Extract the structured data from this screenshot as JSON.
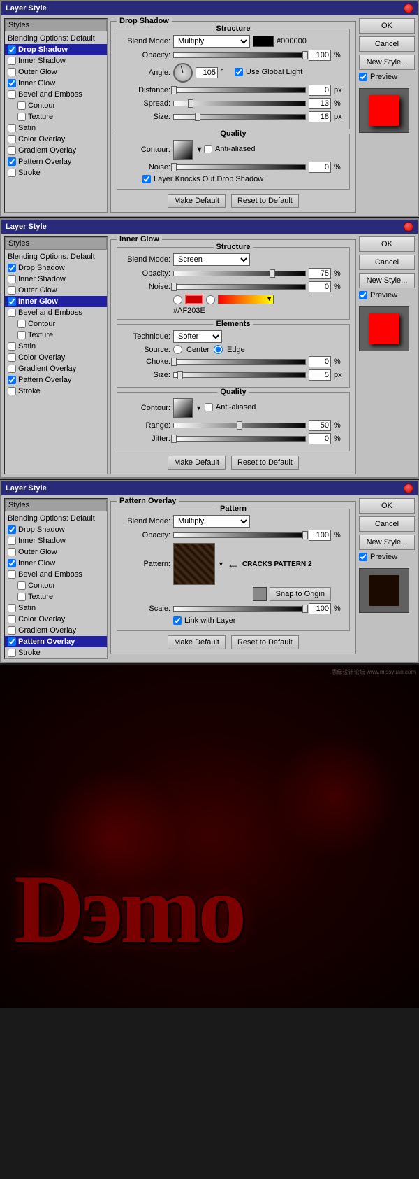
{
  "panel1": {
    "title": "Layer Style",
    "section": "Drop Shadow",
    "structure_label": "Structure",
    "blend_mode_label": "Blend Mode:",
    "blend_mode_value": "Multiply",
    "color_hex": "#000000",
    "opacity_label": "Opacity:",
    "opacity_value": "100",
    "opacity_unit": "%",
    "angle_label": "Angle:",
    "angle_value": "105",
    "angle_unit": "°",
    "use_global_light": "Use Global Light",
    "distance_label": "Distance:",
    "distance_value": "0",
    "distance_unit": "px",
    "spread_label": "Spread:",
    "spread_value": "13",
    "spread_unit": "%",
    "size_label": "Size:",
    "size_value": "18",
    "size_unit": "px",
    "quality_label": "Quality",
    "contour_label": "Contour:",
    "anti_aliased": "Anti-aliased",
    "noise_label": "Noise:",
    "noise_value": "0",
    "noise_unit": "%",
    "layer_knocks": "Layer Knocks Out Drop Shadow",
    "make_default": "Make Default",
    "reset_default": "Reset to Default",
    "ok_label": "OK",
    "cancel_label": "Cancel",
    "new_style_label": "New Style...",
    "preview_label": "Preview",
    "styles": [
      {
        "label": "Blending Options: Default",
        "checked": false,
        "active": false
      },
      {
        "label": "Drop Shadow",
        "checked": true,
        "active": true
      },
      {
        "label": "Inner Shadow",
        "checked": false,
        "active": false
      },
      {
        "label": "Outer Glow",
        "checked": false,
        "active": false
      },
      {
        "label": "Inner Glow",
        "checked": true,
        "active": false
      },
      {
        "label": "Bevel and Emboss",
        "checked": false,
        "active": false
      },
      {
        "label": "Contour",
        "checked": false,
        "sub": true
      },
      {
        "label": "Texture",
        "checked": false,
        "sub": true
      },
      {
        "label": "Satin",
        "checked": false,
        "active": false
      },
      {
        "label": "Color Overlay",
        "checked": false,
        "active": false
      },
      {
        "label": "Gradient Overlay",
        "checked": false,
        "active": false
      },
      {
        "label": "Pattern Overlay",
        "checked": true,
        "active": false
      },
      {
        "label": "Stroke",
        "checked": false,
        "active": false
      }
    ]
  },
  "panel2": {
    "title": "Layer Style",
    "section": "Inner Glow",
    "structure_label": "Structure",
    "blend_mode_label": "Blend Mode:",
    "blend_mode_value": "Screen",
    "opacity_label": "Opacity:",
    "opacity_value": "75",
    "opacity_unit": "%",
    "noise_label": "Noise:",
    "noise_value": "0",
    "noise_unit": "%",
    "color_hex": "#AF203E",
    "elements_label": "Elements",
    "technique_label": "Technique:",
    "technique_value": "Softer",
    "source_label": "Source:",
    "center_label": "Center",
    "edge_label": "Edge",
    "choke_label": "Choke:",
    "choke_value": "0",
    "choke_unit": "%",
    "size_label": "Size:",
    "size_value": "5",
    "size_unit": "px",
    "quality_label": "Quality",
    "contour_label": "Contour:",
    "anti_aliased": "Anti-aliased",
    "range_label": "Range:",
    "range_value": "50",
    "range_unit": "%",
    "jitter_label": "Jitter:",
    "jitter_value": "0",
    "jitter_unit": "%",
    "make_default": "Make Default",
    "reset_default": "Reset to Default",
    "ok_label": "OK",
    "cancel_label": "Cancel",
    "new_style_label": "New Style...",
    "preview_label": "Preview",
    "styles": [
      {
        "label": "Blending Options: Default",
        "checked": false,
        "active": false
      },
      {
        "label": "Drop Shadow",
        "checked": true,
        "active": false
      },
      {
        "label": "Inner Shadow",
        "checked": false,
        "active": false
      },
      {
        "label": "Outer Glow",
        "checked": false,
        "active": false
      },
      {
        "label": "Inner Glow",
        "checked": true,
        "active": true
      },
      {
        "label": "Bevel and Emboss",
        "checked": false,
        "active": false
      },
      {
        "label": "Contour",
        "checked": false,
        "sub": true
      },
      {
        "label": "Texture",
        "checked": false,
        "sub": true
      },
      {
        "label": "Satin",
        "checked": false,
        "active": false
      },
      {
        "label": "Color Overlay",
        "checked": false,
        "active": false
      },
      {
        "label": "Gradient Overlay",
        "checked": false,
        "active": false
      },
      {
        "label": "Pattern Overlay",
        "checked": true,
        "active": false
      },
      {
        "label": "Stroke",
        "checked": false,
        "active": false
      }
    ]
  },
  "panel3": {
    "title": "Layer Style",
    "section": "Pattern Overlay",
    "pattern_label": "Pattern",
    "blend_mode_label": "Blend Mode:",
    "blend_mode_value": "Multiply",
    "opacity_label": "Opacity:",
    "opacity_value": "100",
    "opacity_unit": "%",
    "pattern_label2": "Pattern:",
    "cracks_label": "CRACKS PATTERN 2",
    "snap_label": "Snap to Origin",
    "scale_label": "Scale:",
    "scale_value": "100",
    "scale_unit": "%",
    "link_layer": "Link with Layer",
    "make_default": "Make Default",
    "reset_default": "Reset to Default",
    "ok_label": "OK",
    "cancel_label": "Cancel",
    "new_style_label": "New Style...",
    "preview_label": "Preview",
    "styles": [
      {
        "label": "Blending Options: Default",
        "checked": false,
        "active": false
      },
      {
        "label": "Drop Shadow",
        "checked": true,
        "active": false
      },
      {
        "label": "Inner Shadow",
        "checked": false,
        "active": false
      },
      {
        "label": "Outer Glow",
        "checked": false,
        "active": false
      },
      {
        "label": "Inner Glow",
        "checked": true,
        "active": false
      },
      {
        "label": "Bevel and Emboss",
        "checked": false,
        "active": false
      },
      {
        "label": "Contour",
        "checked": false,
        "sub": true
      },
      {
        "label": "Texture",
        "checked": false,
        "sub": true
      },
      {
        "label": "Satin",
        "checked": false,
        "active": false
      },
      {
        "label": "Color Overlay",
        "checked": false,
        "active": false
      },
      {
        "label": "Gradient Overlay",
        "checked": false,
        "active": false
      },
      {
        "label": "Pattern Overlay",
        "checked": true,
        "active": true
      },
      {
        "label": "Stroke",
        "checked": false,
        "active": false
      }
    ]
  },
  "demo": {
    "text": "Dэmo"
  }
}
